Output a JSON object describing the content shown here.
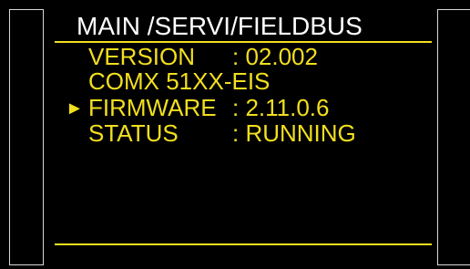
{
  "screen": {
    "title": "MAIN /SERVI/FIELDBUS",
    "accent_color": "#f2df1e",
    "cursor_icon": "triangle-right",
    "cursor_glyph": "►",
    "rows": [
      {
        "label": "VERSION",
        "value": ": 02.002",
        "selected": false
      },
      {
        "label": "COMX 51XX-EIS",
        "value": "",
        "selected": false
      },
      {
        "label": "FIRMWARE",
        "value": ": 2.11.0.6",
        "selected": true
      },
      {
        "label": "STATUS",
        "value": ": RUNNING",
        "selected": false
      }
    ]
  }
}
